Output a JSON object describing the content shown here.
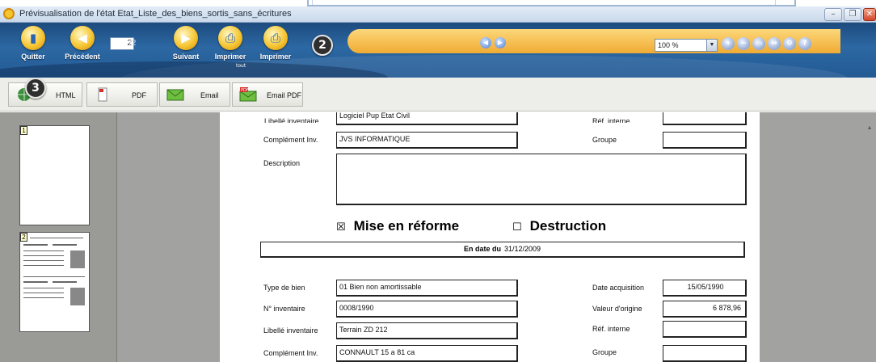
{
  "window": {
    "title": "Prévisualisation de l'état Etat_Liste_des_biens_sortis_sans_écritures",
    "minimize": "–",
    "restore": "❐",
    "close": "✕"
  },
  "toolbar": {
    "quit_label": "Quitter",
    "previous_label": "Précédent",
    "page_current": "2",
    "page_total": "/2",
    "next_label": "Suivant",
    "print_all_label": "Imprimer",
    "print_all_sub": "tout",
    "print_label": "Imprimer",
    "zoom_value": "100 %",
    "badge_2": "2"
  },
  "exportbar": {
    "badge_3": "3",
    "html_label": "HTML",
    "pdf_label": "PDF",
    "email_label": "Email",
    "email_pdf_label": "Email PDF",
    "pdf_icon_text": "PDF"
  },
  "thumbnails": [
    {
      "num": "1"
    },
    {
      "num": "2"
    }
  ],
  "page": {
    "top_label_partial": "Libellé inventaire",
    "top_value_partial": "Logiciel Pup Etat Civil",
    "top_right_label_partial": "Réf. interne",
    "record1": {
      "complement_label": "Complément Inv.",
      "complement_value": "JVS INFORMATIQUE",
      "groupe_label": "Groupe",
      "groupe_value": "",
      "description_label": "Description",
      "description_value": ""
    },
    "mise_en_reforme": "Mise en réforme",
    "destruction": "Destruction",
    "mise_check": "☒",
    "destruction_check": "☐",
    "en_date_du_label": "En date du",
    "en_date_du_value": "31/12/2009",
    "record2": {
      "type_label": "Type de bien",
      "type_value": "01 Bien non amortissable",
      "date_acq_label": "Date acquisition",
      "date_acq_value": "15/05/1990",
      "num_inv_label": "N° inventaire",
      "num_inv_value": "0008/1990",
      "valeur_label": "Valeur d'origine",
      "valeur_value": "6 878,96",
      "libelle_label": "Libellé inventaire",
      "libelle_value": "Terrain ZD 212",
      "ref_label": "Réf. interne",
      "ref_value": "",
      "complement_label": "Complément Inv.",
      "complement_value": "CONNAULT 15 a 81 ca",
      "groupe_label": "Groupe",
      "groupe_value": ""
    }
  }
}
